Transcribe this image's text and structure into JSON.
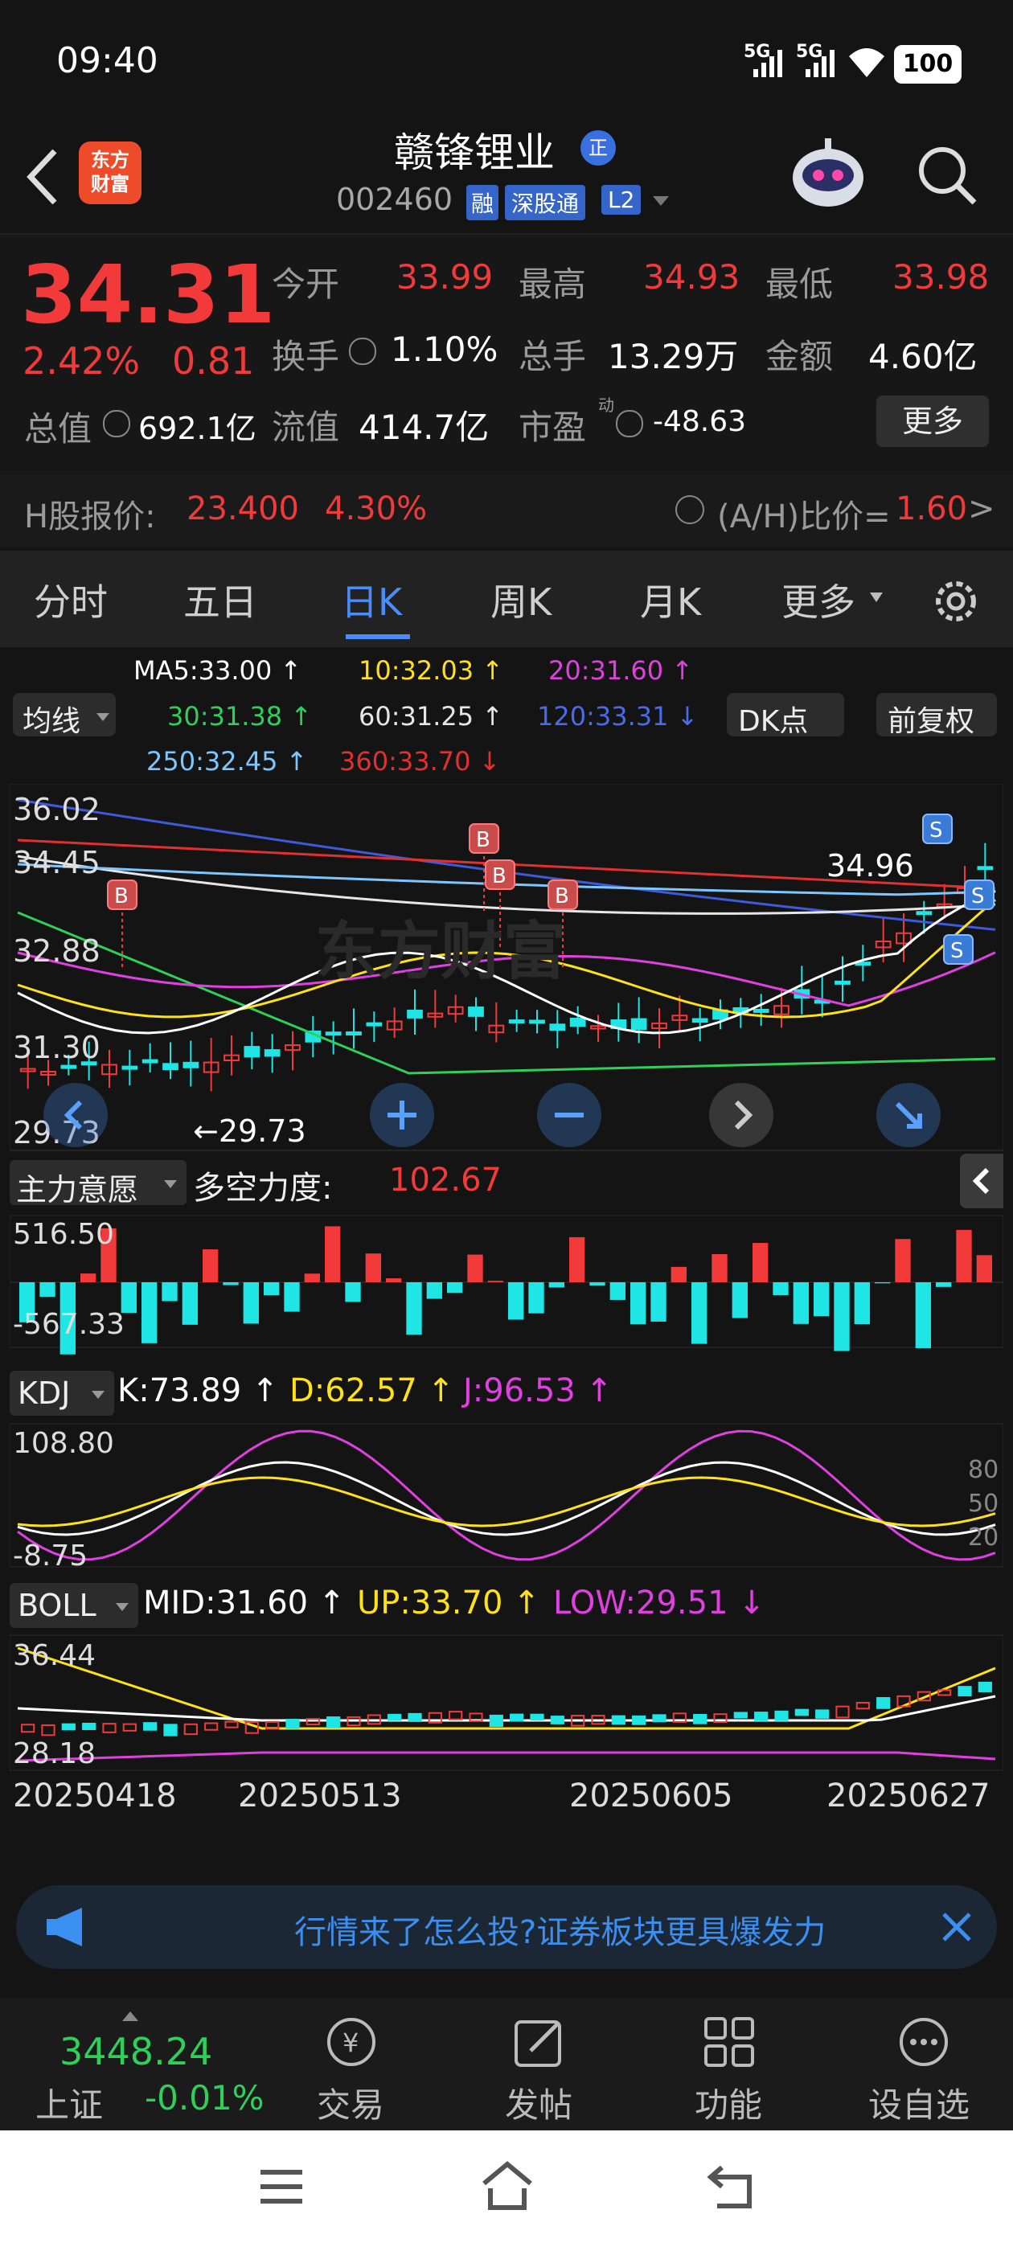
{
  "status": {
    "time": "09:40",
    "battery": "100",
    "net1": "5G",
    "net2": "5G"
  },
  "header": {
    "logo": "东方\n财富",
    "stock_name": "赣锋锂业",
    "badge": "正",
    "code": "002460",
    "tag_rong": "融",
    "tag_sgt": "深股通",
    "tag_l2": "L2"
  },
  "quote": {
    "price": "34.31",
    "pct": "2.42%",
    "chg": "0.81",
    "open_label": "今开",
    "open": "33.99",
    "high_label": "最高",
    "high": "34.93",
    "low_label": "最低",
    "low": "33.98",
    "turnover_label": "换手",
    "turnover": "1.10%",
    "vol_label": "总手",
    "vol": "13.29万",
    "amt_label": "金额",
    "amt": "4.60亿",
    "mcap_label": "总值",
    "mcap": "692.1亿",
    "float_label": "流值",
    "float": "414.7亿",
    "pe_label": "市盈",
    "pe_sup": "动",
    "pe": "-48.63",
    "more": "更多"
  },
  "hshare": {
    "label": "H股报价:",
    "price": "23.400",
    "pct": "4.30%",
    "ah_label": "(A/H)比价=",
    "ah": "1.60",
    "arrow": ">"
  },
  "tabs": [
    "分时",
    "五日",
    "日K",
    "周K",
    "月K",
    "更多"
  ],
  "ma": {
    "selector": "均线",
    "dk": "DK点",
    "fq": "前复权",
    "ma5": "MA5:33.00 ↑",
    "ma10": "10:32.03 ↑",
    "ma20": "20:31.60 ↑",
    "ma30": "30:31.38 ↑",
    "ma60": "60:31.25 ↑",
    "ma120": "120:33.31 ↓",
    "ma250": "250:32.45 ↑",
    "ma360": "360:33.70 ↓"
  },
  "kline": {
    "y1": "36.02",
    "y2": "34.45",
    "y3": "32.88",
    "y4": "31.30",
    "y5": "29.73",
    "hi_note": "34.96",
    "lo_note": "←29.73",
    "watermark": "东方财富"
  },
  "zl": {
    "selector": "主力意愿",
    "label": "多空力度:",
    "value": "102.67",
    "top": "516.50",
    "bottom": "-567.33"
  },
  "kdj": {
    "selector": "KDJ",
    "k": "K:73.89 ↑",
    "d": "D:62.57 ↑",
    "j": "J:96.53 ↑",
    "top": "108.80",
    "bottom": "-8.75",
    "r80": "80",
    "r50": "50",
    "r20": "20"
  },
  "boll": {
    "selector": "BOLL",
    "mid": "MID:31.60 ↑",
    "up": "UP:33.70 ↑",
    "low": "LOW:29.51 ↓",
    "top": "36.44",
    "bottom": "28.18"
  },
  "dates": [
    "20250418",
    "20250513",
    "20250605",
    "20250627"
  ],
  "banner": {
    "text": "行情来了怎么投?证券板块更具爆发力"
  },
  "bottom": {
    "index_value": "3448.24",
    "index_name": "上证",
    "index_pct": "-0.01%",
    "trade": "交易",
    "post": "发帖",
    "func": "功能",
    "watch": "设自选"
  },
  "colors": {
    "up": "#f23a3a",
    "down": "#1fe5e5",
    "accent": "#3a8ff0",
    "ma5": "#ffffff",
    "ma10": "#ffe11a",
    "ma20": "#e040e0",
    "ma30": "#2fd05a",
    "ma120": "#3f5ad8",
    "ma250": "#7cc7ff",
    "ma360": "#e03030"
  }
}
